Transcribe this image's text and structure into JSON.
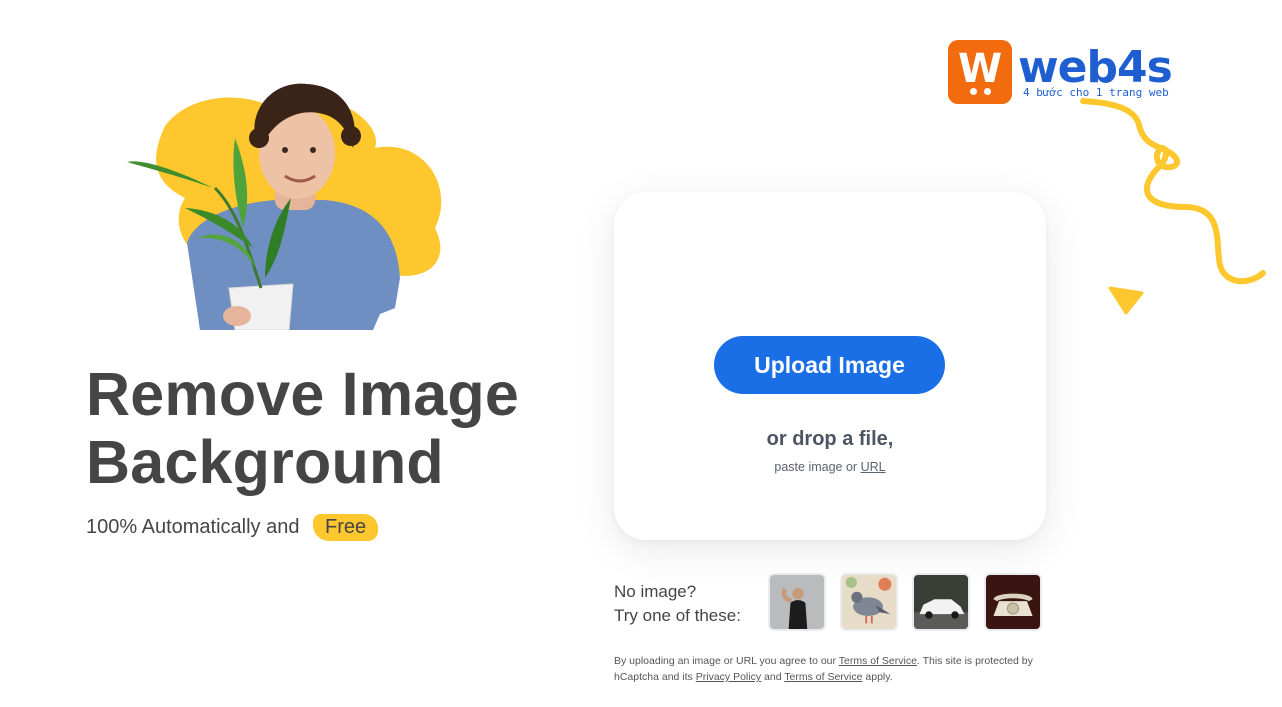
{
  "brand": {
    "name": "web4s",
    "badge_letter": "W",
    "tagline": "4 bước cho 1 trang web",
    "color": "#1f5ed0",
    "badge_color": "#f26b0f"
  },
  "hero": {
    "title": "Remove Image Background",
    "subtitle": "100% Automatically and",
    "free_badge": "Free",
    "accent_color": "#ffc72e"
  },
  "upload": {
    "button_label": "Upload Image",
    "drop_text": "or drop a file,",
    "paste_prefix": "paste image or",
    "url_link": "URL",
    "button_color": "#1a6ee6"
  },
  "samples": {
    "line1": "No image?",
    "line2": "Try one of these:",
    "items": [
      {
        "subject": "woman flexing"
      },
      {
        "subject": "pigeon"
      },
      {
        "subject": "white car"
      },
      {
        "subject": "vintage telephone"
      }
    ]
  },
  "legal": {
    "part1": "By uploading an image or URL you agree to our",
    "tos_link": "Terms of Service",
    "part2": ". This site is protected by hCaptcha and its",
    "privacy_link": "Privacy Policy",
    "part3": "and",
    "tos_link2": "Terms of Service",
    "part4": "apply."
  }
}
